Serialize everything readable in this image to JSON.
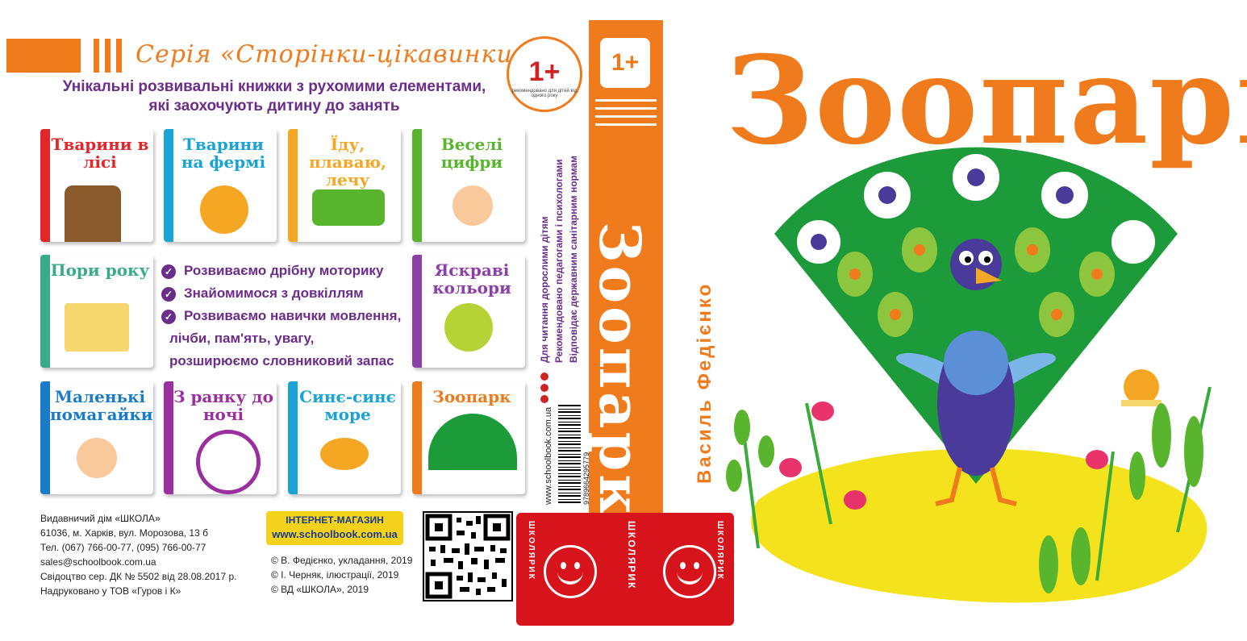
{
  "back_cover": {
    "series_title": "Серія «Сторінки-цікавинки»",
    "subtitle_line1": "Унікальні розвивальні книжки з рухомими елементами,",
    "subtitle_line2": "які заохочують дитину до занять",
    "badge": {
      "age": "1+",
      "text": "рекомендовано для дітей від одного року"
    },
    "books": [
      {
        "title": "Тварини в лісі",
        "color": "#e3262a"
      },
      {
        "title": "Тварини на фермі",
        "color": "#1aa3d4"
      },
      {
        "title": "Їду, плаваю, лечу",
        "color": "#f5a623"
      },
      {
        "title": "Веселі цифри",
        "color": "#5ab52e"
      },
      {
        "title": "Пори року",
        "color": "#3aaa8c"
      },
      {
        "title": "Яскраві кольори",
        "color": "#8c3fa8"
      },
      {
        "title": "Маленькі помагайки",
        "color": "#1a7cc8"
      },
      {
        "title": "З ранку до ночі",
        "color": "#9b2fa0"
      },
      {
        "title": "Синє-синє море",
        "color": "#1aa3d4"
      },
      {
        "title": "Зоопарк",
        "color": "#f07b1c"
      }
    ],
    "features": [
      "Розвиваємо дрібну моторику",
      "Знайомимося з довкіллям",
      "Розвиваємо навички мовлення,"
    ],
    "features_cont": [
      "лічби, пам'ять, увагу,",
      "розширюємо словниковий запас"
    ],
    "publisher": [
      "Видавничий дім «ШКОЛА»",
      "61036, м. Харків, вул. Морозова, 13 б",
      "Тел. (067) 766-00-77, (095) 766-00-77",
      "sales@schoolbook.com.ua",
      "Свідоцтво сер. ДК № 5502 від 28.08.2017 р.",
      "Надруковано у ТОВ «Гуров і К»"
    ],
    "shop": {
      "title": "ІНТЕРНЕТ-МАГАЗИН",
      "url": "www.schoolbook.com.ua"
    },
    "copyright": [
      "© В. Федієнко, укладання, 2019",
      "© І. Черняк, ілюстрації, 2019",
      "© ВД «ШКОЛА», 2019"
    ]
  },
  "info_strip": {
    "line1": "Для читання дорослими дітям",
    "line2": "Рекомендовано педагогами і психологами",
    "line3": "Відповідає державним санітарним нормам",
    "url": "www.schoolbook.com.ua",
    "isbn": "9789664295779"
  },
  "spine": {
    "age": "1+",
    "title": "Зоопарк",
    "brand": "ШКОЛЯРИК"
  },
  "brand": {
    "name": "ШКОЛЯРИК"
  },
  "front_cover": {
    "title": "Зоопарк",
    "author": "Василь Федієнко"
  },
  "colors": {
    "orange": "#f07b1c",
    "purple": "#6b2c8a",
    "red": "#d7141c",
    "green": "#1d9a3a",
    "yellow": "#f4e21c"
  }
}
